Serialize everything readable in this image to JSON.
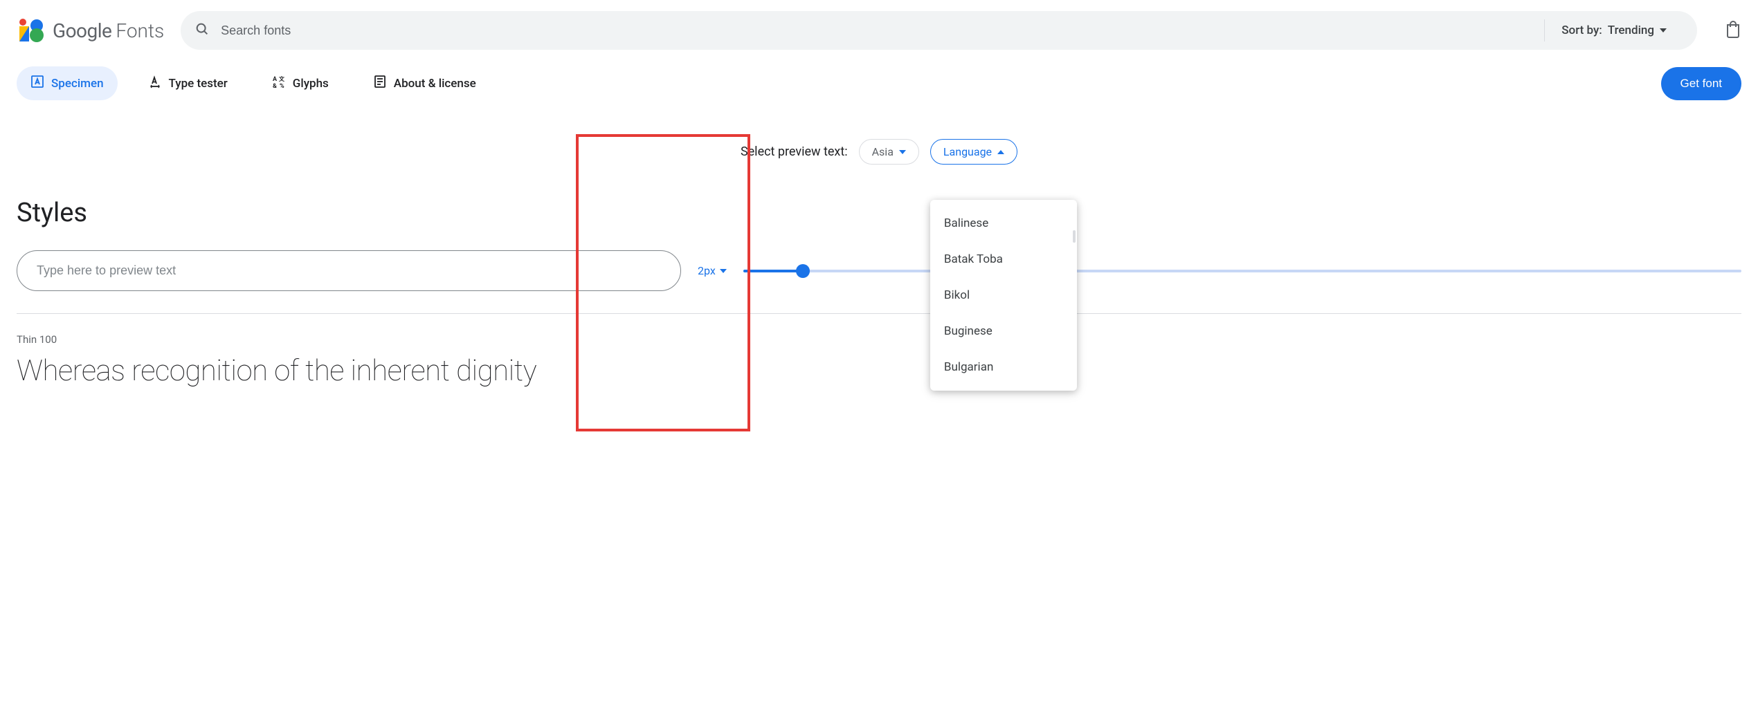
{
  "header": {
    "brand_google": "Google",
    "brand_fonts": "Fonts",
    "search_placeholder": "Search fonts",
    "sort_label": "Sort by:",
    "sort_value": "Trending"
  },
  "tabs": {
    "specimen": "Specimen",
    "type_tester": "Type tester",
    "glyphs": "Glyphs",
    "about": "About & license",
    "get_font": "Get font"
  },
  "preview": {
    "label": "Select preview text:",
    "region": "Asia",
    "language_label": "Language",
    "options": [
      "Balinese",
      "Batak Toba",
      "Bikol",
      "Buginese",
      "Bulgarian"
    ]
  },
  "styles": {
    "heading": "Styles",
    "input_placeholder": "Type here to preview text",
    "size_value": "2px",
    "entries": [
      {
        "label": "Thin 100",
        "sample": "Whereas recognition of the inherent dignity"
      }
    ]
  }
}
